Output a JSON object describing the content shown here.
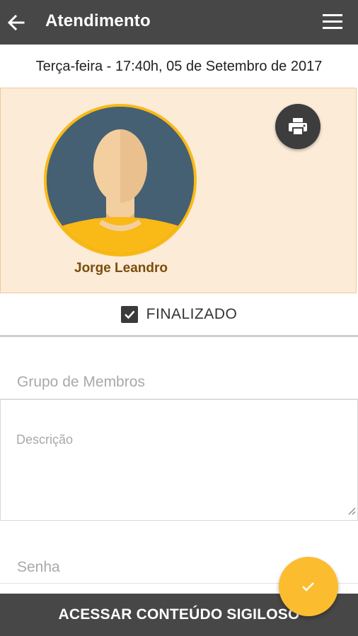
{
  "appbar": {
    "title": "Atendimento",
    "back_icon": "arrow-left-icon",
    "menu_icon": "hamburger-menu-icon",
    "background": "#474747"
  },
  "datetime": "Terça-feira - 17:40h, 05 de Setembro de 2017",
  "profile": {
    "name": "Jorge Leandro",
    "avatar_icon": "user-avatar-icon",
    "print_icon": "printer-icon",
    "background": "#fbebd7",
    "accent": "#f9b916"
  },
  "status": {
    "label": "FINALIZADO",
    "checked": true
  },
  "form": {
    "grupo_placeholder": "Grupo de Membros",
    "grupo_value": "",
    "descricao_placeholder": "Descrição",
    "descricao_value": "",
    "senha_placeholder": "Senha",
    "senha_value": ""
  },
  "bottom_button": {
    "label": "ACESSAR CONTEÚDO SIGILOSO"
  },
  "fab": {
    "icon": "check-icon",
    "color": "#fbbd2f"
  }
}
